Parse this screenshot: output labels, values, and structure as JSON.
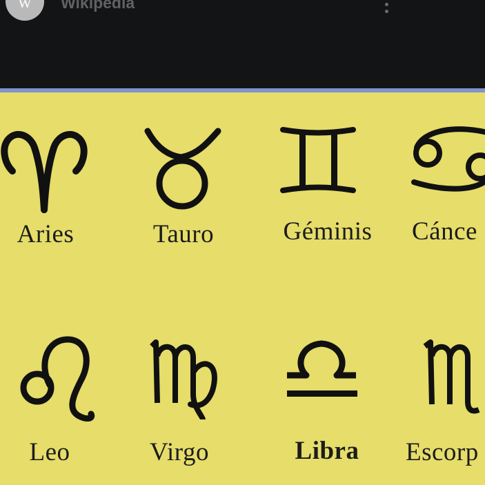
{
  "header": {
    "site_name": "Wikipedia",
    "avatar_letter": "W"
  },
  "colors": {
    "topbar": "#131416",
    "accent": "#8093cf",
    "panel": "#e6dd6a",
    "ink": "#111111"
  },
  "signs": [
    {
      "label": "Aries",
      "icon": "aries-icon"
    },
    {
      "label": "Tauro",
      "icon": "taurus-icon"
    },
    {
      "label": "Géminis",
      "icon": "gemini-icon"
    },
    {
      "label": "Cánce",
      "icon": "cancer-icon"
    },
    {
      "label": "Leo",
      "icon": "leo-icon"
    },
    {
      "label": "Virgo",
      "icon": "virgo-icon"
    },
    {
      "label": "Libra",
      "icon": "libra-icon"
    },
    {
      "label": "Escorp",
      "icon": "scorpio-icon"
    }
  ]
}
